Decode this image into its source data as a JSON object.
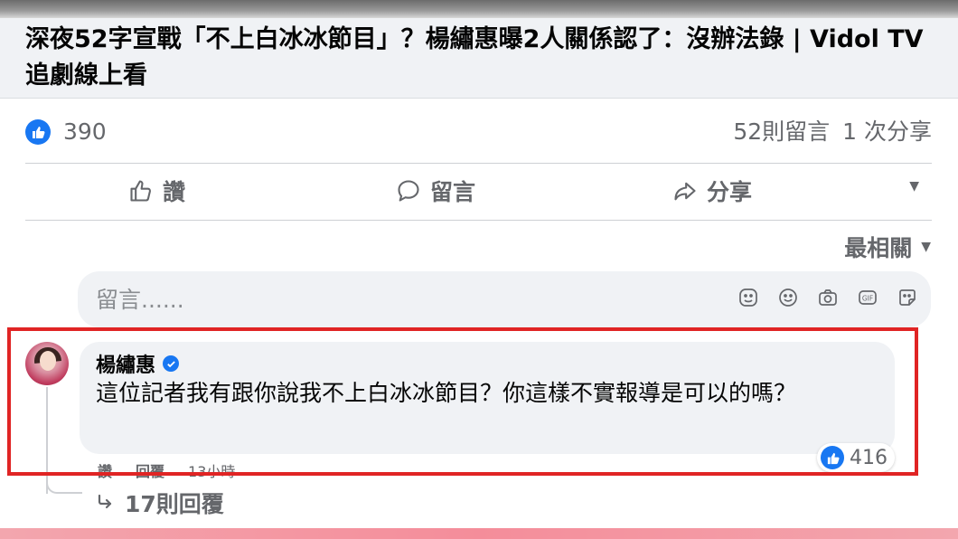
{
  "header": {
    "title": "深夜52字宣戰「不上白冰冰節目」？楊繡惠曝2人關係認了：沒辦法錄 | Vidol TV 追劇線上看"
  },
  "reactions": {
    "like_count": "390",
    "comments_count": "52則留言",
    "shares_count": "1 次分享"
  },
  "actions": {
    "like_label": "讚",
    "comment_label": "留言",
    "share_label": "分享"
  },
  "sort": {
    "label": "最相關"
  },
  "comment_input": {
    "placeholder": "留言......"
  },
  "comment": {
    "author": "楊繡惠",
    "text": "這位記者我有跟你說我不上白冰冰節目？你這樣不實報導是可以的嗎？",
    "like_count": "416",
    "like_action": "讚",
    "reply_action": "回覆",
    "time": "13小時",
    "replies_link": "17則回覆"
  },
  "colors": {
    "accent": "#1877f2",
    "highlight_border": "#e02424",
    "muted_text": "#65676b",
    "bubble_bg": "#f0f2f5"
  },
  "icons": [
    "like-icon",
    "thumbs-up-icon",
    "speech-bubble-icon",
    "share-arrow-icon",
    "caret-down-icon",
    "sticker-icon",
    "emoji-icon",
    "camera-icon",
    "gif-icon",
    "avatar-sticker-icon",
    "verified-badge-icon",
    "reply-arrow-icon"
  ]
}
